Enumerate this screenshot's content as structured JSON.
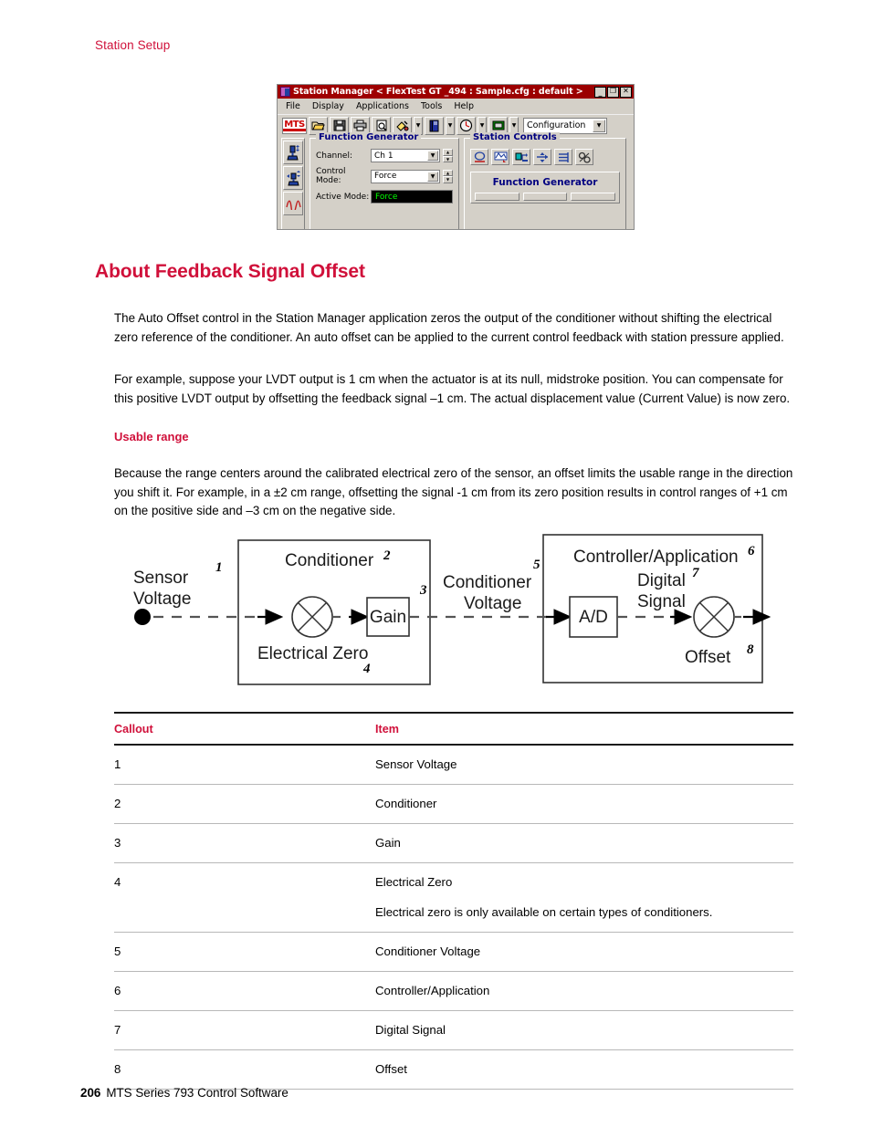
{
  "running_header": "Station Setup",
  "screenshot": {
    "title": "Station Manager  < FlexTest GT _494 : Sample.cfg : default >",
    "window_buttons": [
      {
        "name": "minimize",
        "glyph": "_"
      },
      {
        "name": "maximize",
        "glyph": "❐"
      },
      {
        "name": "close",
        "glyph": "✕"
      }
    ],
    "menus": [
      "File",
      "Display",
      "Applications",
      "Tools",
      "Help"
    ],
    "toolbar": {
      "logo": "MTS",
      "combo_value": "Configuration",
      "buttons": [
        "open-folder-icon",
        "save-disk-icon",
        "print-icon",
        "print-preview-icon",
        "paint-tool-icon",
        "book-icon",
        "meter-icon",
        "monitor-icon"
      ]
    },
    "left_rail": [
      "actuator-icon",
      "actuator-offset-icon",
      "waveform-icon"
    ],
    "function_generator": {
      "legend": "Function Generator",
      "channel_label": "Channel:",
      "channel_value": "Ch 1",
      "control_mode_label": "Control Mode:",
      "control_mode_value": "Force",
      "active_mode_label": "Active Mode:",
      "active_mode_value": "Force"
    },
    "station_controls": {
      "legend": "Station Controls",
      "buttons": [
        "reset-icon",
        "program-icon",
        "manual-command-icon",
        "interlock-icon",
        "hydraulic-icon",
        "settings-icon"
      ],
      "sub_panel_title": "Function Generator"
    }
  },
  "section": {
    "title": "About Feedback Signal Offset",
    "paragraph_1": "The Auto Offset control in the Station Manager application zeros the output of the conditioner without shifting the electrical zero reference of the conditioner. An auto offset can be applied to the current control feedback with station pressure applied.",
    "paragraph_2": "For example, suppose your LVDT output is 1 cm when the actuator is at its null, midstroke position. You can compensate for this positive LVDT output by offsetting the feedback signal –1 cm. The actual displacement value (Current Value) is now zero.",
    "sub_head": "Usable range",
    "paragraph_3": "Because the range centers around the calibrated electrical zero of the sensor, an offset limits the usable range in the direction you shift it. For example, in a ±2 cm range, offsetting the signal -1 cm from its zero position results in control ranges of +1 cm on the positive side and –3 cm on the negative side."
  },
  "diagram": {
    "labels": {
      "sensor_voltage_line1": "Sensor",
      "sensor_voltage_line2": "Voltage",
      "sensor_voltage_callout": "1",
      "conditioner": "Conditioner",
      "conditioner_callout": "2",
      "gain": "Gain",
      "gain_callout": "3",
      "electrical_zero": "Electrical Zero",
      "electrical_zero_callout": "4",
      "conditioner_voltage_line1": "Conditioner",
      "conditioner_voltage_line2": "Voltage",
      "conditioner_voltage_callout": "5",
      "controller_application": "Controller/Application",
      "controller_application_callout": "6",
      "digital_line1": "Digital",
      "digital_line2": "Signal",
      "digital_callout": "7",
      "ad": "A/D",
      "offset": "Offset",
      "offset_callout": "8"
    }
  },
  "table": {
    "headers": [
      "Callout",
      "Item"
    ],
    "rows": [
      {
        "callout": "1",
        "item": "Sensor Voltage",
        "note": ""
      },
      {
        "callout": "2",
        "item": "Conditioner",
        "note": ""
      },
      {
        "callout": "3",
        "item": "Gain",
        "note": ""
      },
      {
        "callout": "4",
        "item": "Electrical Zero",
        "note": "Electrical zero is only available on certain types of conditioners."
      },
      {
        "callout": "5",
        "item": "Conditioner Voltage",
        "note": ""
      },
      {
        "callout": "6",
        "item": "Controller/Application",
        "note": ""
      },
      {
        "callout": "7",
        "item": "Digital Signal",
        "note": ""
      },
      {
        "callout": "8",
        "item": "Offset",
        "note": ""
      }
    ]
  },
  "footer": {
    "page_number": "206",
    "book_title": "MTS Series 793 Control Software"
  },
  "colors": {
    "accent_crimson": "#D0103A",
    "titlebar_red": "#9e0000",
    "panel_legend_blue": "#000080",
    "active_mode_green": "#00ff00"
  }
}
